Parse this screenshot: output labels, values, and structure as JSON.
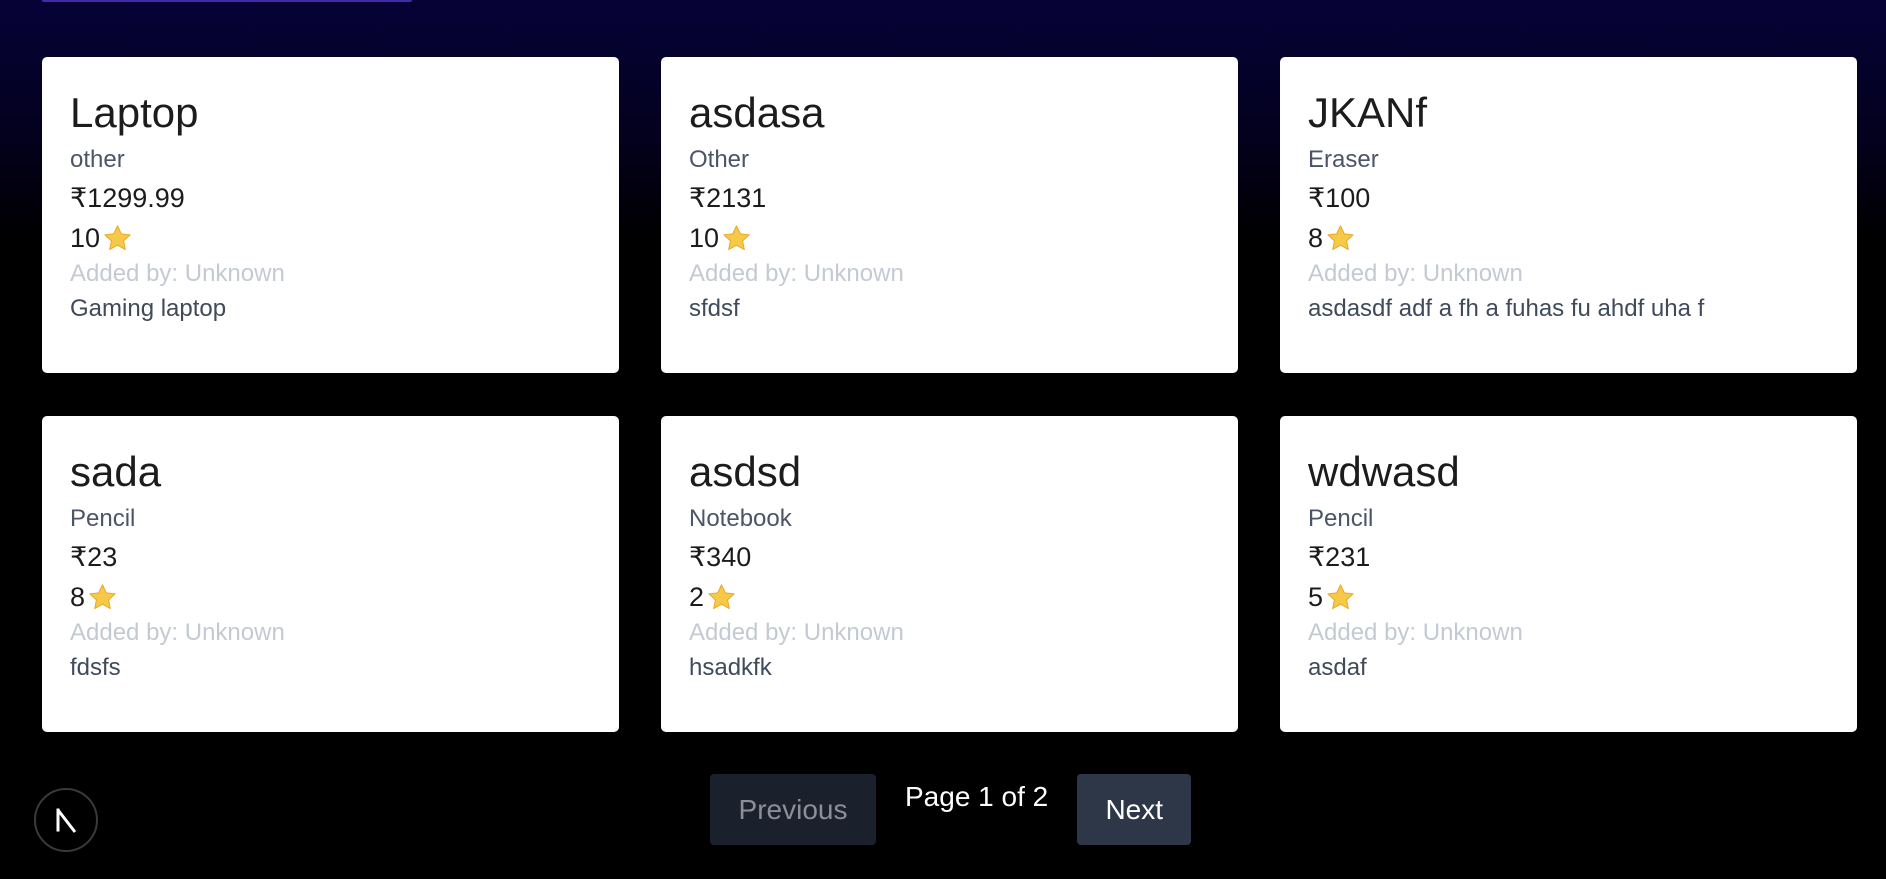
{
  "products": [
    {
      "name": "Laptop",
      "category": "other",
      "price": "₹1299.99",
      "rating": "10",
      "added_by": "Added by: Unknown",
      "description": "Gaming laptop"
    },
    {
      "name": "asdasa",
      "category": "Other",
      "price": "₹2131",
      "rating": "10",
      "added_by": "Added by: Unknown",
      "description": "sfdsf"
    },
    {
      "name": "JKANf",
      "category": "Eraser",
      "price": "₹100",
      "rating": "8",
      "added_by": "Added by: Unknown",
      "description": "asdasdf adf a fh a fuhas fu ahdf uha f"
    },
    {
      "name": "sada",
      "category": "Pencil",
      "price": "₹23",
      "rating": "8",
      "added_by": "Added by: Unknown",
      "description": "fdsfs"
    },
    {
      "name": "asdsd",
      "category": "Notebook",
      "price": "₹340",
      "rating": "2",
      "added_by": "Added by: Unknown",
      "description": "hsadkfk"
    },
    {
      "name": "wdwasd",
      "category": "Pencil",
      "price": "₹231",
      "rating": "5",
      "added_by": "Added by: Unknown",
      "description": "asdaf"
    }
  ],
  "rating_icon": "star-icon",
  "pagination": {
    "previous_label": "Previous",
    "page_label": "Page 1 of 2",
    "next_label": "Next",
    "previous_disabled": true
  },
  "dev_badge": {
    "icon": "nextjs-logo-icon"
  },
  "colors": {
    "card_bg": "#ffffff",
    "star": "#f7c948",
    "next_button": "#2d3748",
    "previous_button": "#1a202c",
    "background_top": "#060238"
  }
}
